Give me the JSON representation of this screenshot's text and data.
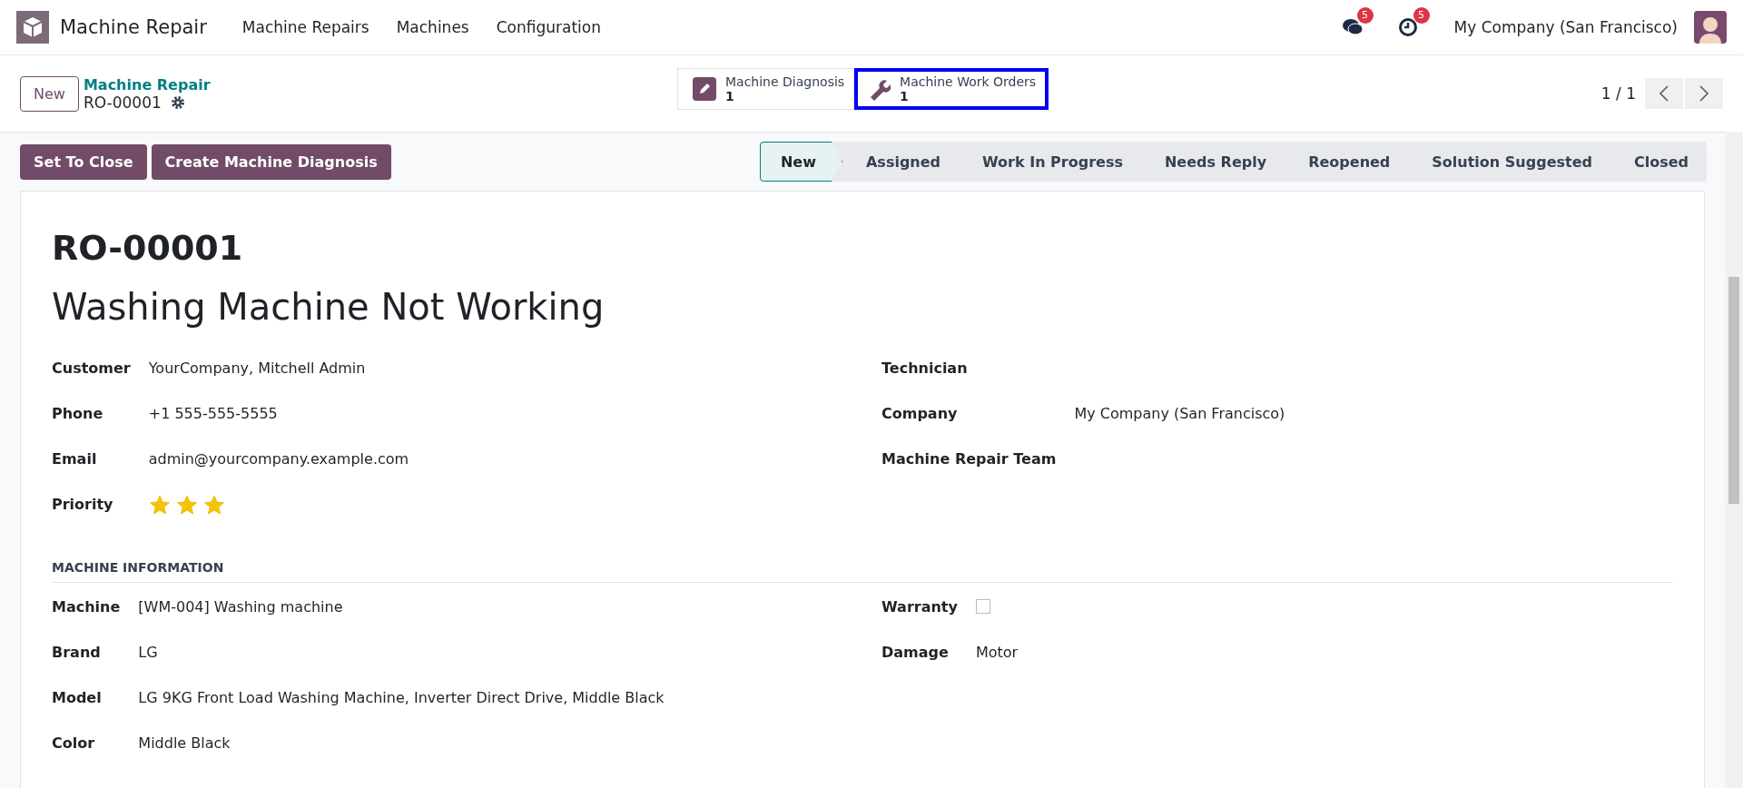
{
  "navbar": {
    "app_name": "Machine Repair",
    "menu": [
      "Machine Repairs",
      "Machines",
      "Configuration"
    ],
    "messages_count": "5",
    "activities_count": "5",
    "company": "My Company (San Francisco)"
  },
  "control_panel": {
    "new_button": "New",
    "breadcrumb": "Machine Repair",
    "record_name": "RO-00001",
    "smart_buttons": [
      {
        "kind": "pencil",
        "label": "Machine Diagnosis",
        "value": "1",
        "selected": false
      },
      {
        "kind": "wrench",
        "label": "Machine Work Orders",
        "value": "1",
        "selected": true
      }
    ],
    "pager": "1 / 1"
  },
  "actions": [
    "Set To Close",
    "Create Machine Diagnosis"
  ],
  "stages": [
    {
      "label": "New",
      "selected": true
    },
    {
      "label": "Assigned",
      "selected": false
    },
    {
      "label": "Work In Progress",
      "selected": false
    },
    {
      "label": "Needs Reply",
      "selected": false
    },
    {
      "label": "Reopened",
      "selected": false
    },
    {
      "label": "Solution Suggested",
      "selected": false
    },
    {
      "label": "Closed",
      "selected": false
    }
  ],
  "form": {
    "reference": "RO-00001",
    "title": "Washing Machine Not Working",
    "sections": [
      {
        "left": [
          {
            "kind": "text",
            "label": "Customer",
            "value": "YourCompany, Mitchell Admin"
          },
          {
            "kind": "text",
            "label": "Phone",
            "value": "+1 555-555-5555"
          },
          {
            "kind": "text",
            "label": "Email",
            "value": "admin@yourcompany.example.com"
          },
          {
            "kind": "stars",
            "label": "Priority",
            "stars": 3
          }
        ],
        "right": [
          {
            "kind": "text",
            "label": "Technician"
          },
          {
            "kind": "text",
            "label": "Company",
            "value": "My Company (San Francisco)"
          },
          {
            "kind": "text",
            "label": "Machine Repair Team"
          }
        ]
      },
      {
        "heading": "MACHINE INFORMATION",
        "left": [
          {
            "kind": "text",
            "label": "Machine",
            "value": "[WM-004] Washing machine"
          },
          {
            "kind": "text",
            "label": "Brand",
            "value": "LG"
          },
          {
            "kind": "text",
            "label": "Model",
            "value": "LG 9KG Front Load Washing Machine, Inverter Direct Drive, Middle Black"
          },
          {
            "kind": "text",
            "label": "Color",
            "value": "Middle Black"
          }
        ],
        "right": [
          {
            "kind": "checkbox",
            "label": "Warranty",
            "checked": false
          },
          {
            "kind": "text",
            "label": "Damage",
            "value": "Motor"
          }
        ]
      }
    ]
  }
}
